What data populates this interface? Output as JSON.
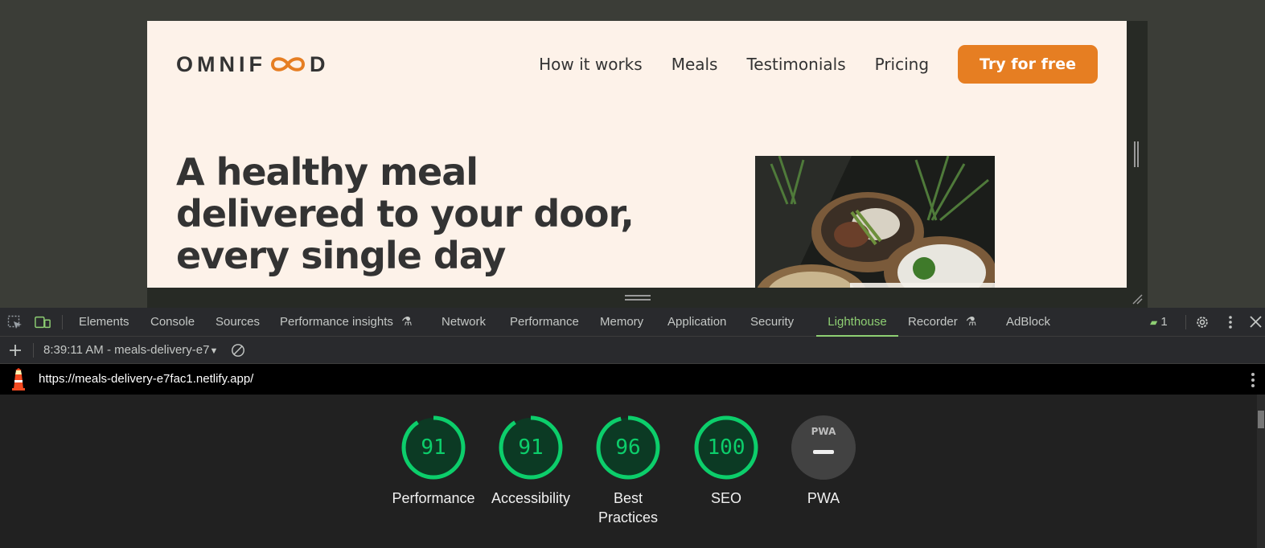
{
  "site": {
    "logo_text_left": "OMNIF",
    "logo_text_right": "D",
    "nav": [
      "How it works",
      "Meals",
      "Testimonials",
      "Pricing"
    ],
    "cta": "Try for free",
    "hero_title": "A healthy meal delivered to your door, every single day",
    "colors": {
      "accent": "#e67e22",
      "background": "#fdf2e9",
      "text": "#333333"
    }
  },
  "devtools": {
    "tabs": [
      "Elements",
      "Console",
      "Sources",
      "Performance insights",
      "Network",
      "Performance",
      "Memory",
      "Application",
      "Security",
      "Lighthouse",
      "Recorder",
      "AdBlock"
    ],
    "active_tab": "Lighthouse",
    "issues_count": "1",
    "report_label": "8:39:11 AM - meals-delivery-e7",
    "url": "https://meals-delivery-e7fac1.netlify.app/"
  },
  "lighthouse": {
    "scores": [
      {
        "label": "Performance",
        "value": "91"
      },
      {
        "label": "Accessibility",
        "value": "91"
      },
      {
        "label": "Best Practices",
        "value": "96"
      },
      {
        "label": "SEO",
        "value": "100"
      }
    ],
    "pwa": {
      "label": "PWA",
      "badge": "PWA"
    },
    "colors": {
      "pass": "#0cce6b"
    }
  }
}
